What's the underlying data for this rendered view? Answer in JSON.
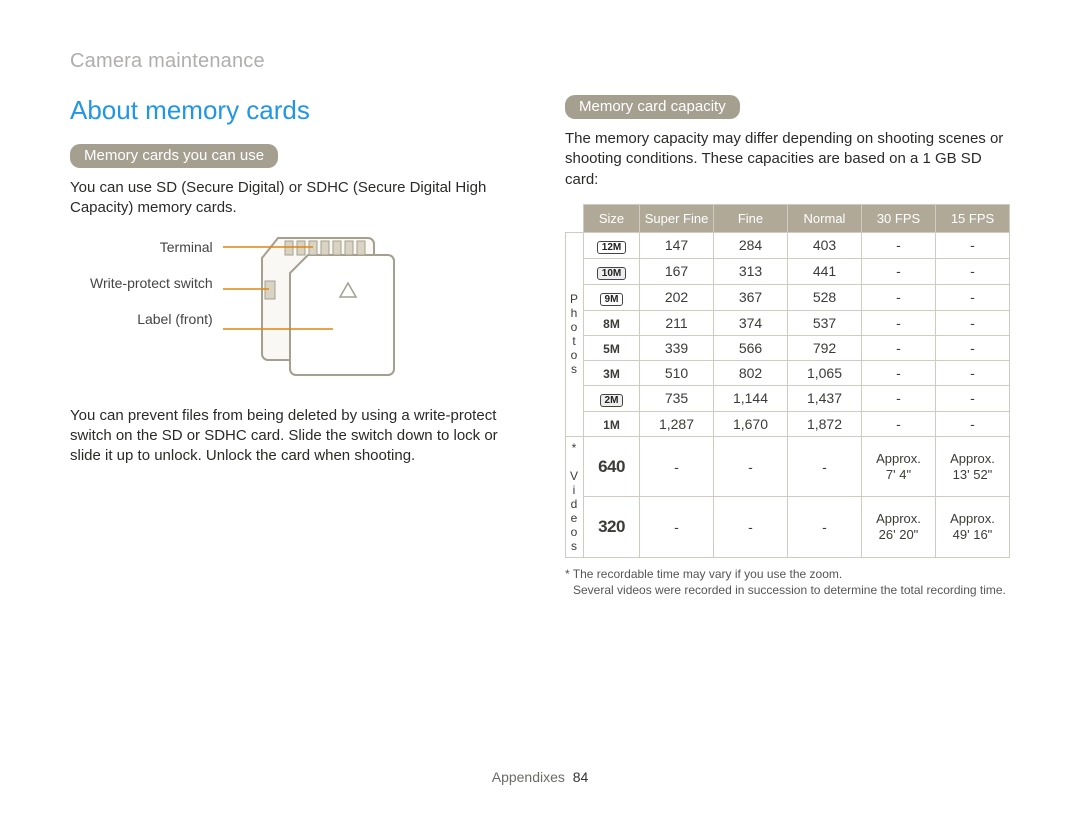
{
  "breadcrumb": "Camera maintenance",
  "title": "About memory cards",
  "left": {
    "pill1": "Memory cards you can use",
    "para1": "You can use SD (Secure Digital) or SDHC (Secure Digital High Capacity) memory cards.",
    "sd_labels": {
      "terminal": "Terminal",
      "switch": "Write-protect switch",
      "label": "Label (front)"
    },
    "para2": "You can prevent files from being deleted by using a write-protect switch on the SD or SDHC card. Slide the switch down to lock or slide it up to unlock. Unlock the card when shooting."
  },
  "right": {
    "pill2": "Memory card capacity",
    "intro": "The memory capacity may differ depending on shooting scenes or shooting conditions. These capacities are based on a 1 GB SD card:",
    "headers": [
      "Size",
      "Super Fine",
      "Fine",
      "Normal",
      "30 FPS",
      "15 FPS"
    ],
    "side_photos": "Photos",
    "side_videos": "* Videos",
    "photo_rows": [
      {
        "size": "12M",
        "chip": "chip",
        "sf": "147",
        "f": "284",
        "n": "403",
        "fp30": "-",
        "fp15": "-"
      },
      {
        "size": "10M",
        "chip": "chipwide",
        "sf": "167",
        "f": "313",
        "n": "441",
        "fp30": "-",
        "fp15": "-"
      },
      {
        "size": "9M",
        "chip": "chip",
        "sf": "202",
        "f": "367",
        "n": "528",
        "fp30": "-",
        "fp15": "-"
      },
      {
        "size": "8M",
        "chip": "plain",
        "sf": "211",
        "f": "374",
        "n": "537",
        "fp30": "-",
        "fp15": "-"
      },
      {
        "size": "5M",
        "chip": "plain",
        "sf": "339",
        "f": "566",
        "n": "792",
        "fp30": "-",
        "fp15": "-"
      },
      {
        "size": "3M",
        "chip": "plain",
        "sf": "510",
        "f": "802",
        "n": "1,065",
        "fp30": "-",
        "fp15": "-"
      },
      {
        "size": "2M",
        "chip": "chipwide",
        "sf": "735",
        "f": "1,144",
        "n": "1,437",
        "fp30": "-",
        "fp15": "-"
      },
      {
        "size": "1M",
        "chip": "plain",
        "sf": "1,287",
        "f": "1,670",
        "n": "1,872",
        "fp30": "-",
        "fp15": "-"
      }
    ],
    "video_rows": [
      {
        "size": "640",
        "sf": "-",
        "f": "-",
        "n": "-",
        "fp30": "Approx. 7' 4\"",
        "fp15": "Approx. 13' 52\""
      },
      {
        "size": "320",
        "sf": "-",
        "f": "-",
        "n": "-",
        "fp30": "Approx. 26' 20\"",
        "fp15": "Approx. 49' 16\""
      }
    ],
    "footnote1": "* The recordable time may vary if you use the zoom.",
    "footnote2": "Several videos were recorded in succession to determine the total recording time."
  },
  "footer": {
    "section": "Appendixes",
    "page": "84"
  }
}
